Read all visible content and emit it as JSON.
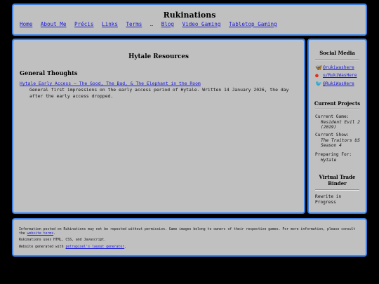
{
  "site": {
    "title": "Rukinations"
  },
  "nav": {
    "home": "Home",
    "about": "About Me",
    "precis": "Précis",
    "links": "Links",
    "terms": "Terms",
    "sep": "…",
    "blog": "Blog",
    "video_gaming": "Video Gaming",
    "tabletop_gaming": "Tabletop Gaming"
  },
  "main": {
    "title": "Hytale Resources",
    "section_heading": "General Thoughts",
    "article_link": "Hytale Early Access — The Good, The Bad, & The Elephant in the Room",
    "article_desc": "General first impressions on the early access period of Hytale. Written 14 January 2026, the day after the early access dropped."
  },
  "sidebar": {
    "social_heading": "Social Media",
    "socials": [
      {
        "icon": "bluesky-icon",
        "label": "@rukiwashere"
      },
      {
        "icon": "reddit-icon",
        "label": "u/RukiWasHere"
      },
      {
        "icon": "twitter-icon",
        "label": "@RukiWasHere"
      }
    ],
    "projects_heading": "Current Projects",
    "current_game_label": "Current Game:",
    "current_game_value": "Resident Evil 2 (2019)",
    "current_show_label": "Current Show:",
    "current_show_value": "The Traitors US Season 4",
    "preparing_label": "Preparing For:",
    "preparing_value": "Hytale",
    "binder_heading": "Virtual Trade Binder",
    "binder_status": "Rewrite in Progress"
  },
  "footer": {
    "line1_pre": "Information posted on Rukinations may not be reposted without permission. Game images belong to owners of their respective games. For more information, please consult the",
    "line1_link": "website terms",
    "line1_post": ".",
    "line2": "Rukinations uses HTML, CSS, and Javascript.",
    "line3_pre": "Website generated with",
    "line3_link": "petrapixel's layout generator",
    "line3_post": "."
  },
  "colors": {
    "panel": "#c0c0c0",
    "border": "#3d7fdc",
    "link": "#1a1ad6",
    "background": "#000000"
  }
}
